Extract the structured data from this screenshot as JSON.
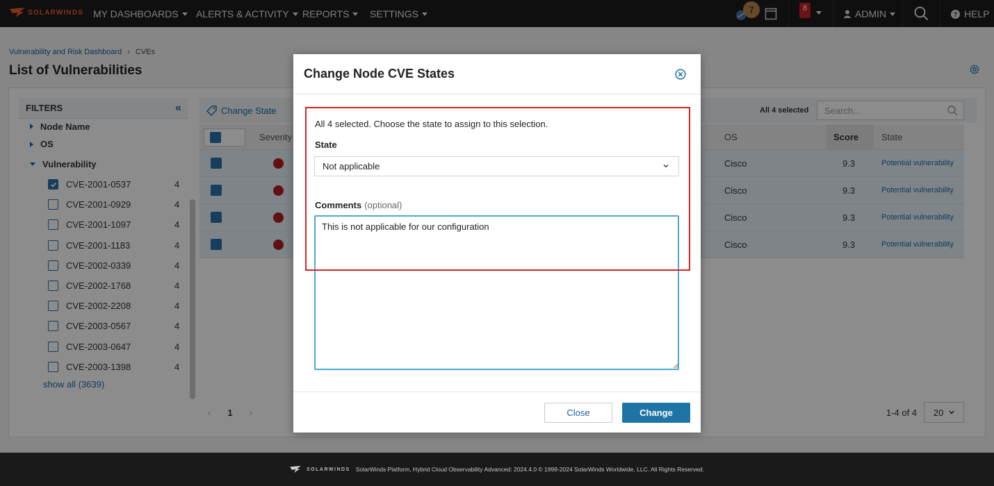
{
  "nav": {
    "logo_text": "SOLARWINDS",
    "menu": [
      "MY DASHBOARDS",
      "ALERTS & ACTIVITY",
      "REPORTS",
      "SETTINGS"
    ],
    "notify_badge": "7",
    "alerts_badge": "8",
    "user": "ADMIN",
    "help": "HELP"
  },
  "breadcrumb": {
    "parent": "Vulnerability and Risk Dashboard",
    "current": "CVEs"
  },
  "page_title": "List of Vulnerabilities",
  "filters": {
    "title": "FILTERS",
    "groups": [
      "Node Name",
      "OS",
      "Vulnerability"
    ],
    "cves": [
      {
        "id": "CVE-2001-0537",
        "count": "4",
        "checked": true
      },
      {
        "id": "CVE-2001-0929",
        "count": "4",
        "checked": false
      },
      {
        "id": "CVE-2001-1097",
        "count": "4",
        "checked": false
      },
      {
        "id": "CVE-2001-1183",
        "count": "4",
        "checked": false
      },
      {
        "id": "CVE-2002-0339",
        "count": "4",
        "checked": false
      },
      {
        "id": "CVE-2002-1768",
        "count": "4",
        "checked": false
      },
      {
        "id": "CVE-2002-2208",
        "count": "4",
        "checked": false
      },
      {
        "id": "CVE-2003-0567",
        "count": "4",
        "checked": false
      },
      {
        "id": "CVE-2003-0647",
        "count": "4",
        "checked": false
      },
      {
        "id": "CVE-2003-1398",
        "count": "4",
        "checked": false
      }
    ],
    "show_all": "show all (3639)"
  },
  "toolbar": {
    "change_state": "Change State",
    "selected": "All 4 selected",
    "search_placeholder": "Search..."
  },
  "grid": {
    "headers": {
      "severity": "Severity",
      "os": "OS",
      "score": "Score",
      "state": "State"
    },
    "rows": [
      {
        "os": "Cisco",
        "score": "9.3",
        "state": "Potential vulnerability"
      },
      {
        "os": "Cisco",
        "score": "9.3",
        "state": "Potential vulnerability"
      },
      {
        "os": "Cisco",
        "score": "9.3",
        "state": "Potential vulnerability"
      },
      {
        "os": "Cisco",
        "score": "9.3",
        "state": "Potential vulnerability"
      }
    ],
    "page": "1",
    "range": "1-4 of 4",
    "page_size": "20"
  },
  "modal": {
    "title": "Change Node CVE States",
    "info": "All 4 selected. Choose the state to assign to this selection.",
    "state_label": "State",
    "state_value": "Not applicable",
    "comments_label": "Comments",
    "comments_optional": "(optional)",
    "comments_value": "This is not applicable for our configuration",
    "close_label": "Close",
    "change_label": "Change"
  },
  "footer": {
    "logo_text": "SOLARWINDS",
    "text": "SolarWinds Platform, Hybrid Cloud Observability Advanced: 2024.4.0 © 1999-2024 SolarWinds Worldwide, LLC. All Rights Reserved."
  },
  "colors": {
    "accent": "#1f74a6",
    "brand": "#f0602a",
    "highlight": "#e02020",
    "severity": "#b01e1e"
  }
}
